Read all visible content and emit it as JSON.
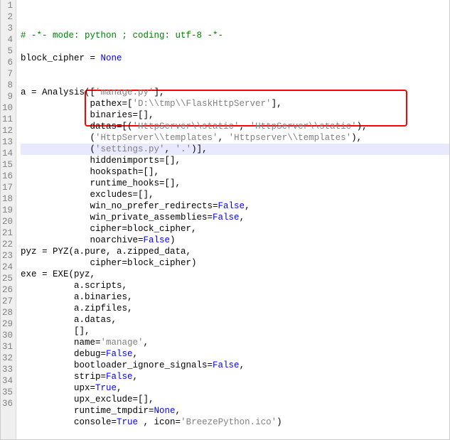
{
  "lines": [
    {
      "num": "1",
      "cls": "",
      "seg": [
        [
          "comment",
          "# -*- mode: python ; coding: utf-8 -*-"
        ]
      ]
    },
    {
      "num": "2",
      "cls": "",
      "seg": [
        [
          "plain",
          ""
        ]
      ]
    },
    {
      "num": "3",
      "cls": "",
      "seg": [
        [
          "plain",
          "block_cipher = "
        ],
        [
          "keyword",
          "None"
        ]
      ]
    },
    {
      "num": "4",
      "cls": "",
      "seg": [
        [
          "plain",
          ""
        ]
      ]
    },
    {
      "num": "5",
      "cls": "",
      "seg": [
        [
          "plain",
          ""
        ]
      ]
    },
    {
      "num": "6",
      "cls": "",
      "seg": [
        [
          "plain",
          "a = Analysis(["
        ],
        [
          "string",
          "'manage.py'"
        ],
        [
          "plain",
          "],"
        ]
      ]
    },
    {
      "num": "7",
      "cls": "",
      "seg": [
        [
          "plain",
          "             pathex=["
        ],
        [
          "string",
          "'D:\\\\tmp\\\\FlaskHttpServer'"
        ],
        [
          "plain",
          "],"
        ]
      ]
    },
    {
      "num": "8",
      "cls": "",
      "seg": [
        [
          "plain",
          "             binaries=[],"
        ]
      ]
    },
    {
      "num": "9",
      "cls": "",
      "seg": [
        [
          "plain",
          "             datas=[("
        ],
        [
          "string",
          "'HttpServer\\\\static'"
        ],
        [
          "plain",
          ", "
        ],
        [
          "string",
          "'HttpServer\\\\static'"
        ],
        [
          "plain",
          "),"
        ]
      ]
    },
    {
      "num": "10",
      "cls": "",
      "seg": [
        [
          "plain",
          "             ("
        ],
        [
          "string",
          "'HttpServer\\\\templates'"
        ],
        [
          "plain",
          ", "
        ],
        [
          "string",
          "'Httpserver\\\\templates'"
        ],
        [
          "plain",
          "),"
        ]
      ]
    },
    {
      "num": "11",
      "cls": "hl-line",
      "seg": [
        [
          "plain",
          "             ("
        ],
        [
          "string",
          "'settings.py'"
        ],
        [
          "plain",
          ", "
        ],
        [
          "string",
          "'.'"
        ],
        [
          "plain",
          ")],"
        ]
      ]
    },
    {
      "num": "12",
      "cls": "",
      "seg": [
        [
          "plain",
          "             hiddenimports=[],"
        ]
      ]
    },
    {
      "num": "13",
      "cls": "",
      "seg": [
        [
          "plain",
          "             hookspath=[],"
        ]
      ]
    },
    {
      "num": "14",
      "cls": "",
      "seg": [
        [
          "plain",
          "             runtime_hooks=[],"
        ]
      ]
    },
    {
      "num": "15",
      "cls": "",
      "seg": [
        [
          "plain",
          "             excludes=[],"
        ]
      ]
    },
    {
      "num": "16",
      "cls": "",
      "seg": [
        [
          "plain",
          "             win_no_prefer_redirects="
        ],
        [
          "keyword",
          "False"
        ],
        [
          "plain",
          ","
        ]
      ]
    },
    {
      "num": "17",
      "cls": "",
      "seg": [
        [
          "plain",
          "             win_private_assemblies="
        ],
        [
          "keyword",
          "False"
        ],
        [
          "plain",
          ","
        ]
      ]
    },
    {
      "num": "18",
      "cls": "",
      "seg": [
        [
          "plain",
          "             cipher=block_cipher,"
        ]
      ]
    },
    {
      "num": "19",
      "cls": "",
      "seg": [
        [
          "plain",
          "             noarchive="
        ],
        [
          "keyword",
          "False"
        ],
        [
          "plain",
          ")"
        ]
      ]
    },
    {
      "num": "20",
      "cls": "",
      "seg": [
        [
          "plain",
          "pyz = PYZ(a.pure, a.zipped_data,"
        ]
      ]
    },
    {
      "num": "21",
      "cls": "",
      "seg": [
        [
          "plain",
          "             cipher=block_cipher)"
        ]
      ]
    },
    {
      "num": "22",
      "cls": "",
      "seg": [
        [
          "plain",
          "exe = EXE(pyz,"
        ]
      ]
    },
    {
      "num": "23",
      "cls": "",
      "seg": [
        [
          "plain",
          "          a.scripts,"
        ]
      ]
    },
    {
      "num": "24",
      "cls": "",
      "seg": [
        [
          "plain",
          "          a.binaries,"
        ]
      ]
    },
    {
      "num": "25",
      "cls": "",
      "seg": [
        [
          "plain",
          "          a.zipfiles,"
        ]
      ]
    },
    {
      "num": "26",
      "cls": "",
      "seg": [
        [
          "plain",
          "          a.datas,"
        ]
      ]
    },
    {
      "num": "27",
      "cls": "",
      "seg": [
        [
          "plain",
          "          [],"
        ]
      ]
    },
    {
      "num": "28",
      "cls": "",
      "seg": [
        [
          "plain",
          "          name="
        ],
        [
          "string",
          "'manage'"
        ],
        [
          "plain",
          ","
        ]
      ]
    },
    {
      "num": "29",
      "cls": "",
      "seg": [
        [
          "plain",
          "          debug="
        ],
        [
          "keyword",
          "False"
        ],
        [
          "plain",
          ","
        ]
      ]
    },
    {
      "num": "30",
      "cls": "",
      "seg": [
        [
          "plain",
          "          bootloader_ignore_signals="
        ],
        [
          "keyword",
          "False"
        ],
        [
          "plain",
          ","
        ]
      ]
    },
    {
      "num": "31",
      "cls": "",
      "seg": [
        [
          "plain",
          "          strip="
        ],
        [
          "keyword",
          "False"
        ],
        [
          "plain",
          ","
        ]
      ]
    },
    {
      "num": "32",
      "cls": "",
      "seg": [
        [
          "plain",
          "          upx="
        ],
        [
          "keyword",
          "True"
        ],
        [
          "plain",
          ","
        ]
      ]
    },
    {
      "num": "33",
      "cls": "",
      "seg": [
        [
          "plain",
          "          upx_exclude=[],"
        ]
      ]
    },
    {
      "num": "34",
      "cls": "",
      "seg": [
        [
          "plain",
          "          runtime_tmpdir="
        ],
        [
          "keyword",
          "None"
        ],
        [
          "plain",
          ","
        ]
      ]
    },
    {
      "num": "35",
      "cls": "",
      "seg": [
        [
          "plain",
          "          console="
        ],
        [
          "keyword",
          "True"
        ],
        [
          "plain",
          " , icon="
        ],
        [
          "string",
          "'BreezePython.ico'"
        ],
        [
          "plain",
          ")"
        ]
      ]
    },
    {
      "num": "36",
      "cls": "",
      "seg": [
        [
          "plain",
          ""
        ]
      ]
    }
  ],
  "annotation": {
    "name": "datas-highlight-box"
  }
}
